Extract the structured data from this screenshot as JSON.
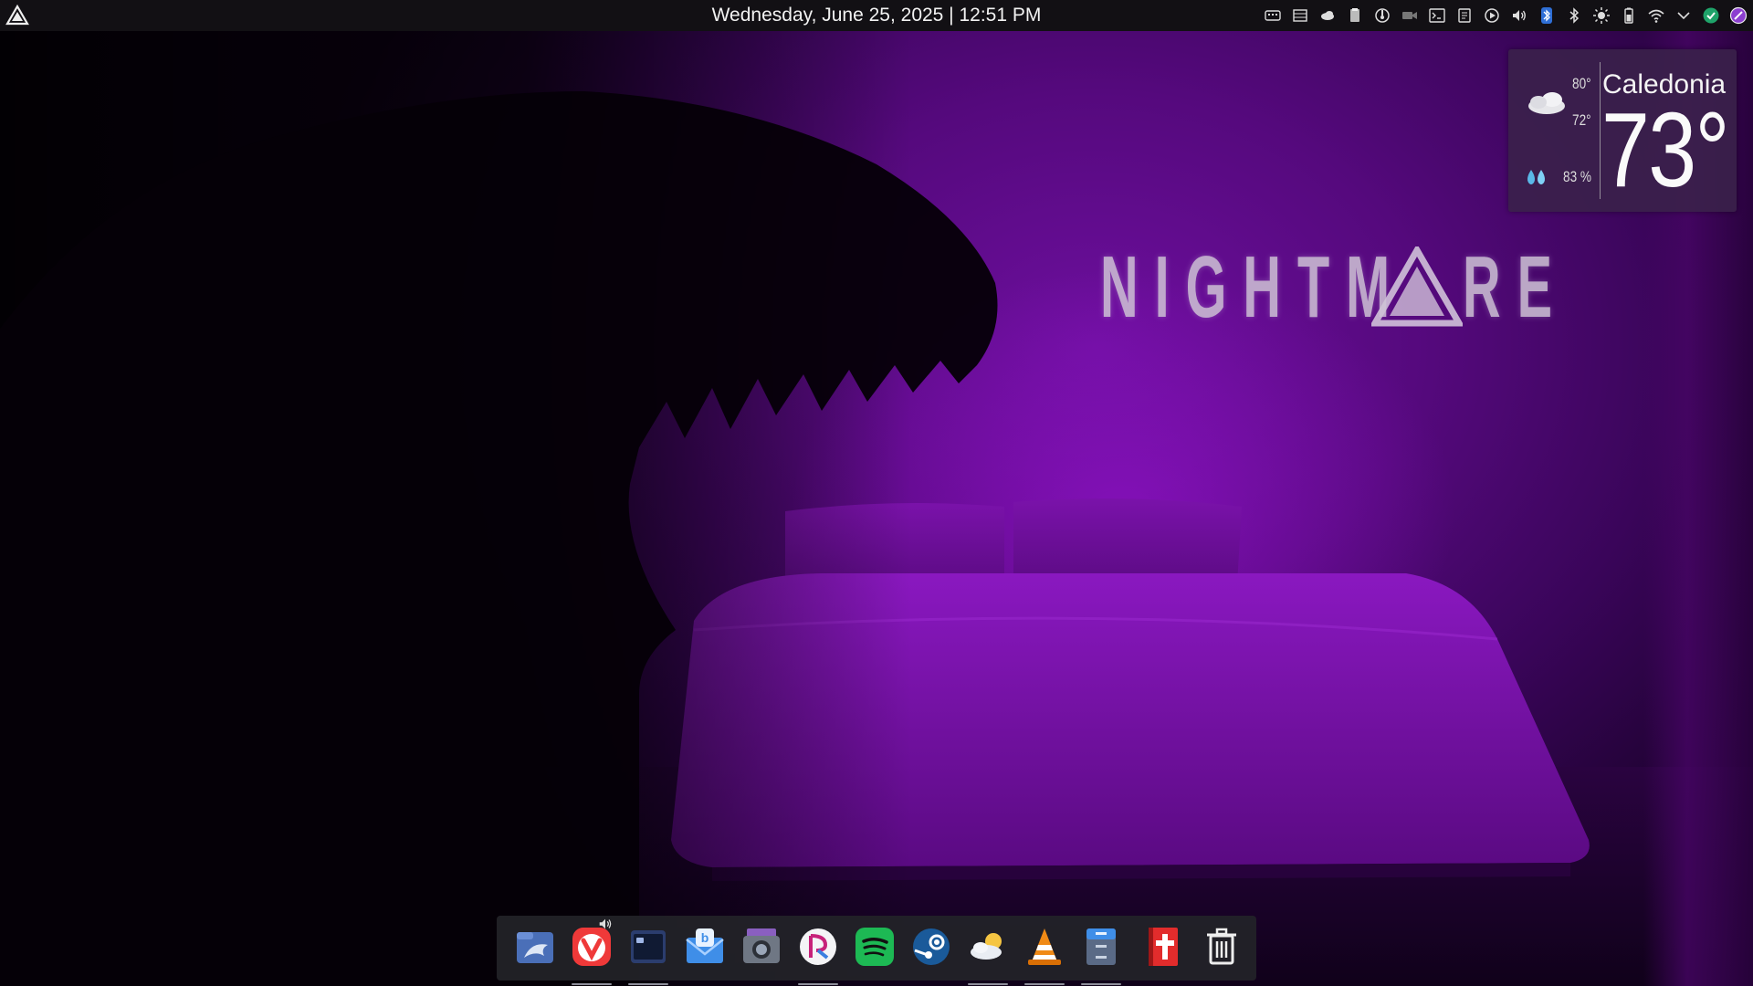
{
  "panel": {
    "clock_text": "Wednesday, June 25, 2025 | 12:51 PM",
    "launcher_icon": "nightmare-triangle-icon",
    "tray_icons": [
      "keyboard-layout-icon",
      "network-monitor-icon",
      "weather-cloud-icon",
      "clipboard-icon",
      "cpu-monitor-icon",
      "camera-icon",
      "terminal-icon",
      "notes-icon",
      "media-play-icon",
      "volume-icon",
      "bluetooth-app-icon",
      "bluetooth-icon",
      "brightness-icon",
      "battery-icon",
      "wifi-icon",
      "chevron-down-icon",
      "updates-icon",
      "notifications-icon"
    ]
  },
  "wallpaper": {
    "logo_text": "NIGHTM",
    "logo_text_end": "RE",
    "logo_color": "#cfc3d6",
    "accent": "#6d0f9e"
  },
  "weather": {
    "high": "80°",
    "low": "72°",
    "humidity": "83 %",
    "city": "Caledonia",
    "temperature": "73°",
    "condition_icon": "cloudy-icon"
  },
  "dock": {
    "apps": [
      {
        "name": "dolphin-file-manager",
        "running": false
      },
      {
        "name": "vivaldi-browser",
        "running": true,
        "badge": "speaker-icon"
      },
      {
        "name": "konsole-terminal",
        "running": true
      },
      {
        "name": "mail-client",
        "running": false
      },
      {
        "name": "screenshot-tool",
        "running": false
      },
      {
        "name": "media-player",
        "running": true
      },
      {
        "name": "spotify",
        "running": false
      },
      {
        "name": "steam",
        "running": false
      },
      {
        "name": "weather-app",
        "running": true
      },
      {
        "name": "vlc-player",
        "running": true
      },
      {
        "name": "files-manager",
        "running": true
      },
      {
        "name": "bible-app",
        "running": false
      },
      {
        "name": "trash",
        "running": false
      }
    ]
  }
}
